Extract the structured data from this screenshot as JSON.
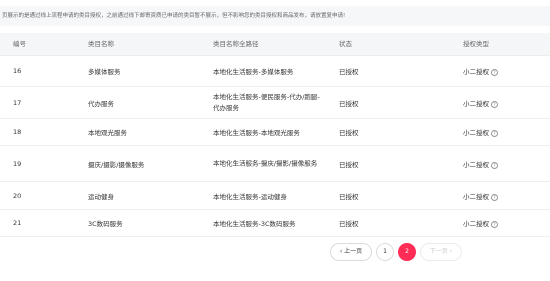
{
  "notice": "页展示的是通过线上流程申请的类目授权，之前通过线下邮寄资质已申请的类目暂不展示，但不影响您的类目授权和商品发布，请放置复申请!",
  "table": {
    "headers": {
      "id": "编号",
      "name": "类目名称",
      "full_path": "类目名称全路径",
      "status": "状态",
      "auth_type": "授权类型"
    },
    "rows": [
      {
        "id": "16",
        "name": "多媒体服务",
        "full_path": "本地化生活服务-多媒体服务",
        "status": "已授权",
        "auth_type": "小二授权"
      },
      {
        "id": "17",
        "name": "代办服务",
        "full_path": "本地化生活服务-便民服务-代办/跑腿-代办服务",
        "status": "已授权",
        "auth_type": "小二授权"
      },
      {
        "id": "18",
        "name": "本地观光服务",
        "full_path": "本地化生活服务-本地观光服务",
        "status": "已授权",
        "auth_type": "小二授权"
      },
      {
        "id": "19",
        "name": "摄庆/摄影/摄像服务",
        "full_path": "本地化生活服务-摄庆/摄影/摄像服务",
        "status": "已授权",
        "auth_type": "小二授权"
      },
      {
        "id": "20",
        "name": "运动健身",
        "full_path": "本地化生活服务-运动健身",
        "status": "已授权",
        "auth_type": "小二授权"
      },
      {
        "id": "21",
        "name": "3C数码服务",
        "full_path": "本地化生活服务-3C数码服务",
        "status": "已授权",
        "auth_type": "小二授权"
      }
    ],
    "help_icon": "?"
  },
  "pagination": {
    "prev": "‹ 上一页",
    "pages": [
      "1",
      "2"
    ],
    "next": "下一页 ›",
    "current": "2"
  }
}
